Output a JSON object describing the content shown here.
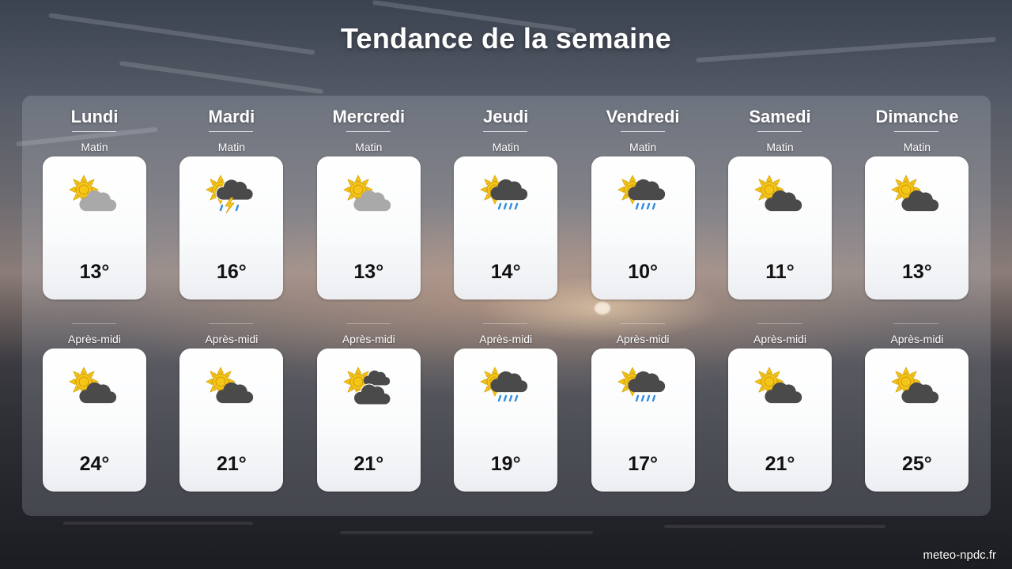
{
  "title": "Tendance de la semaine",
  "credit": "meteo-npdc.fr",
  "labels": {
    "morning": "Matin",
    "afternoon": "Après-midi"
  },
  "days": [
    {
      "name": "Lundi",
      "morning": {
        "icon": "sun-behind-light-cloud",
        "temp": "13°"
      },
      "afternoon": {
        "icon": "sun-behind-dark-cloud",
        "temp": "24°"
      }
    },
    {
      "name": "Mardi",
      "morning": {
        "icon": "sun-thunderstorm",
        "temp": "16°"
      },
      "afternoon": {
        "icon": "sun-behind-dark-cloud",
        "temp": "21°"
      }
    },
    {
      "name": "Mercredi",
      "morning": {
        "icon": "sun-behind-light-cloud",
        "temp": "13°"
      },
      "afternoon": {
        "icon": "sun-behind-two-dark-clouds",
        "temp": "21°"
      }
    },
    {
      "name": "Jeudi",
      "morning": {
        "icon": "sun-rain-cloud",
        "temp": "14°"
      },
      "afternoon": {
        "icon": "sun-rain-cloud",
        "temp": "19°"
      }
    },
    {
      "name": "Vendredi",
      "morning": {
        "icon": "sun-rain-cloud",
        "temp": "10°"
      },
      "afternoon": {
        "icon": "sun-rain-cloud",
        "temp": "17°"
      }
    },
    {
      "name": "Samedi",
      "morning": {
        "icon": "sun-behind-dark-cloud",
        "temp": "11°"
      },
      "afternoon": {
        "icon": "sun-behind-dark-cloud",
        "temp": "21°"
      }
    },
    {
      "name": "Dimanche",
      "morning": {
        "icon": "sun-behind-dark-cloud",
        "temp": "13°"
      },
      "afternoon": {
        "icon": "sun-behind-dark-cloud",
        "temp": "25°"
      }
    }
  ],
  "colors": {
    "sun": "#f5c518",
    "sun_outline": "#d9a300",
    "light_cloud": "#a9a9a9",
    "dark_cloud": "#4a4a4a",
    "rain": "#2f8ee0",
    "lightning": "#f5c518"
  }
}
